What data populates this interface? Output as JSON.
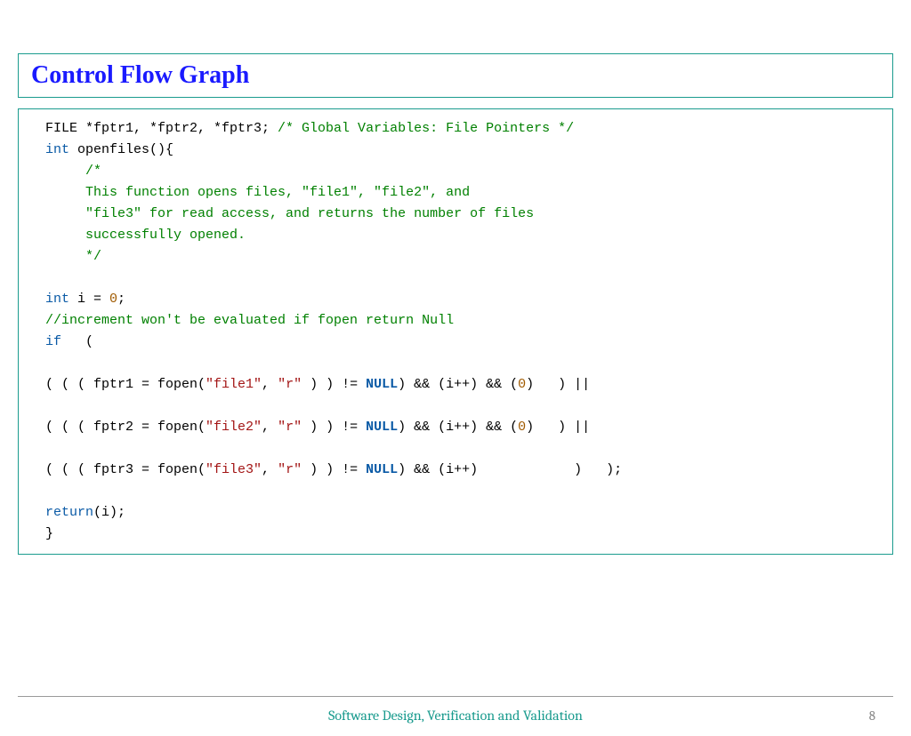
{
  "slide": {
    "title": "Control Flow Graph",
    "footer": "Software Design,  Verification and Validation",
    "page": "8"
  },
  "code": {
    "l1a": "FILE *fptr1, *fptr2, *fptr3; ",
    "l1b": "/* Global Variables: File Pointers */",
    "l2a": "int",
    "l2b": " openfiles(){",
    "l3": "     /*",
    "l4": "     This function opens files, \"file1\", \"file2\", and",
    "l5": "     \"file3\" for read access, and returns the number of files",
    "l6": "     successfully opened.",
    "l7": "     */",
    "l8": "",
    "l9a": "int",
    "l9b": " i = ",
    "l9c": "0",
    "l9d": ";",
    "l10": "//increment won't be evaluated if fopen return Null",
    "l11a": "if",
    "l11b": "   (",
    "l12": "",
    "l13a": "( ( ( fptr1 = fopen(",
    "l13b": "\"file1\"",
    "l13c": ", ",
    "l13d": "\"r\"",
    "l13e": " ) ) != ",
    "l13f": "NULL",
    "l13g": ") && (i++) && (",
    "l13h": "0",
    "l13i": ")   ) ||",
    "l14": "",
    "l15a": "( ( ( fptr2 = fopen(",
    "l15b": "\"file2\"",
    "l15c": ", ",
    "l15d": "\"r\"",
    "l15e": " ) ) != ",
    "l15f": "NULL",
    "l15g": ") && (i++) && (",
    "l15h": "0",
    "l15i": ")   ) ||",
    "l16": "",
    "l17a": "( ( ( fptr3 = fopen(",
    "l17b": "\"file3\"",
    "l17c": ", ",
    "l17d": "\"r\"",
    "l17e": " ) ) != ",
    "l17f": "NULL",
    "l17g": ") && (i++)            )   );",
    "l18": "",
    "l19a": "return",
    "l19b": "(i);",
    "l20": "}"
  }
}
